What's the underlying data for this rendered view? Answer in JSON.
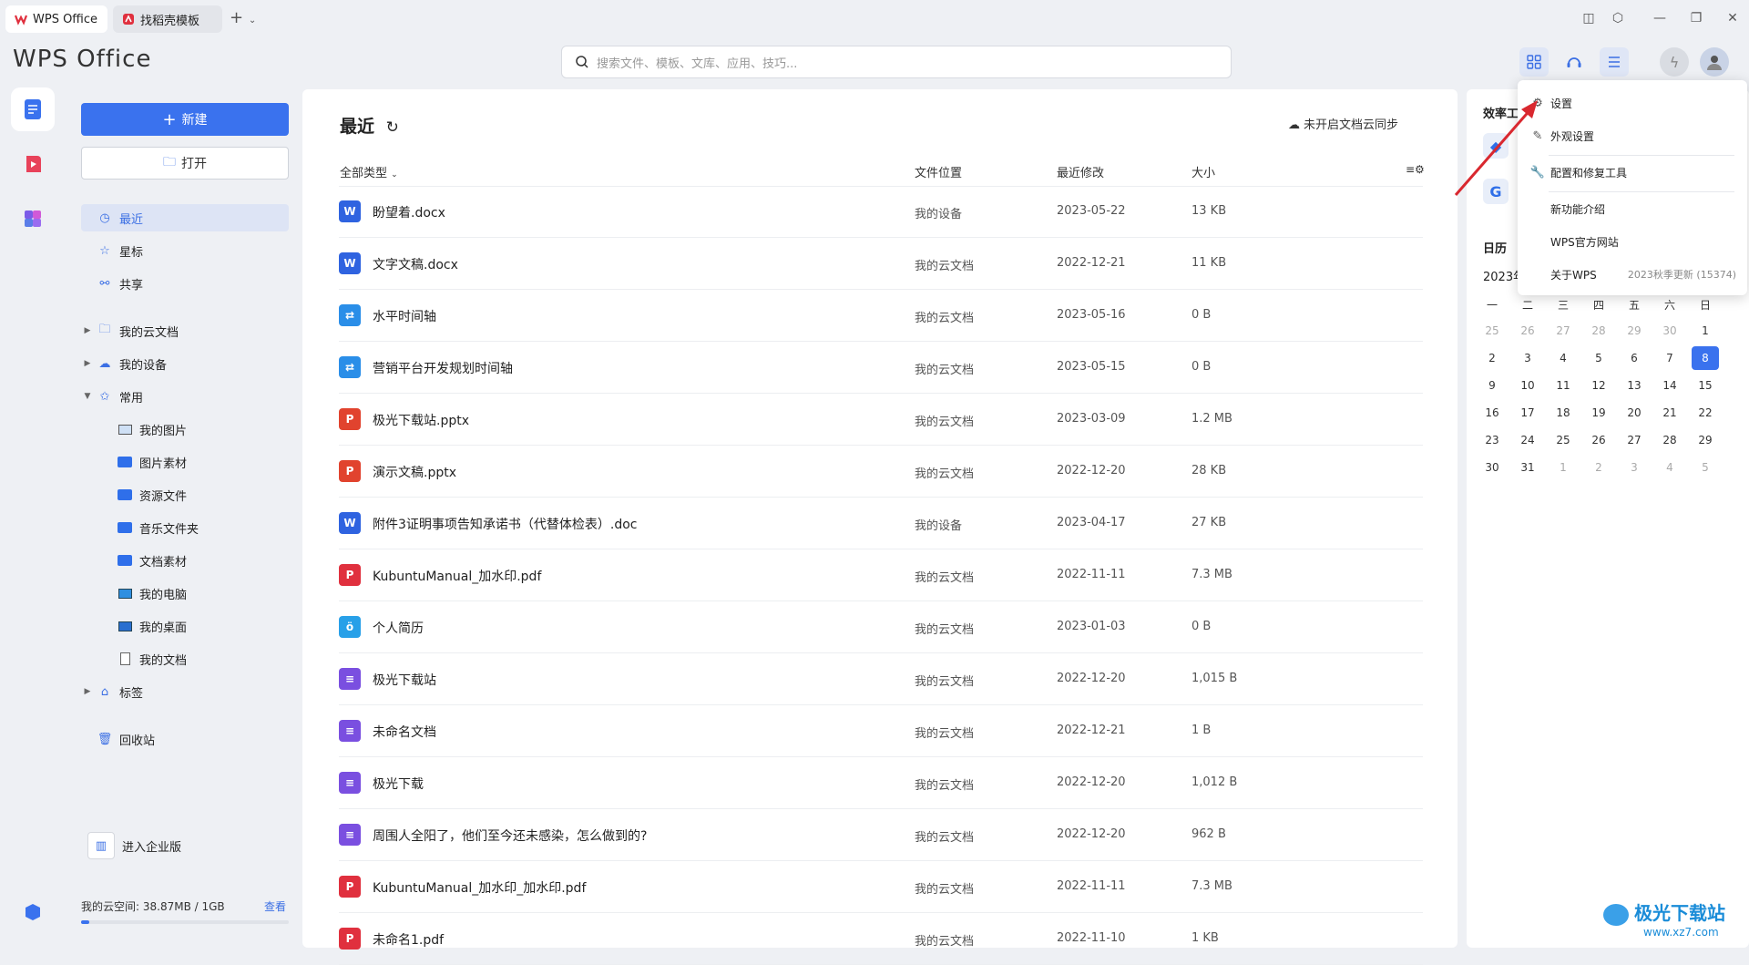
{
  "tabs": [
    {
      "label": "WPS Office"
    },
    {
      "label": "找稻壳模板"
    }
  ],
  "brand": "WPS Office",
  "search": {
    "placeholder": "搜索文件、模板、文库、应用、技巧..."
  },
  "sidebar": {
    "new_label": "新建",
    "open_label": "打开",
    "items": [
      {
        "label": "最近"
      },
      {
        "label": "星标"
      },
      {
        "label": "共享"
      },
      {
        "label": "我的云文档"
      },
      {
        "label": "我的设备"
      },
      {
        "label": "常用"
      },
      {
        "label": "我的图片"
      },
      {
        "label": "图片素材"
      },
      {
        "label": "资源文件"
      },
      {
        "label": "音乐文件夹"
      },
      {
        "label": "文档素材"
      },
      {
        "label": "我的电脑"
      },
      {
        "label": "我的桌面"
      },
      {
        "label": "我的文档"
      },
      {
        "label": "标签"
      },
      {
        "label": "回收站"
      }
    ],
    "enterprise_label": "进入企业版",
    "cloud_space": "我的云空间: 38.87MB / 1GB",
    "cloud_view": "查看",
    "cloud_usage_fraction": 0.038
  },
  "main": {
    "title": "最近",
    "sync_status": "未开启文档云同步",
    "columns": {
      "type": "全部类型",
      "location": "文件位置",
      "modified": "最近修改",
      "size": "大小"
    },
    "files": [
      {
        "name": "盼望着.docx",
        "location": "我的设备",
        "date": "2023-05-22",
        "size": "13 KB",
        "icon": "W",
        "color": "#2f63e0"
      },
      {
        "name": "文字文稿.docx",
        "location": "我的云文档",
        "date": "2022-12-21",
        "size": "11 KB",
        "icon": "W",
        "color": "#2f63e0"
      },
      {
        "name": "水平时间轴",
        "location": "我的云文档",
        "date": "2023-05-16",
        "size": "0 B",
        "icon": "⇄",
        "color": "#2a8ee8"
      },
      {
        "name": "营销平台开发规划时间轴",
        "location": "我的云文档",
        "date": "2023-05-15",
        "size": "0 B",
        "icon": "⇄",
        "color": "#2a8ee8"
      },
      {
        "name": "极光下载站.pptx",
        "location": "我的云文档",
        "date": "2023-03-09",
        "size": "1.2 MB",
        "icon": "P",
        "color": "#e1432e"
      },
      {
        "name": "演示文稿.pptx",
        "location": "我的云文档",
        "date": "2022-12-20",
        "size": "28 KB",
        "icon": "P",
        "color": "#e1432e"
      },
      {
        "name": "附件3证明事项告知承诺书（代替体检表）.doc",
        "location": "我的设备",
        "date": "2023-04-17",
        "size": "27 KB",
        "icon": "W",
        "color": "#2f63e0"
      },
      {
        "name": "KubuntuManual_加水印.pdf",
        "location": "我的云文档",
        "date": "2022-11-11",
        "size": "7.3 MB",
        "icon": "P",
        "color": "#e0303e"
      },
      {
        "name": "个人简历",
        "location": "我的云文档",
        "date": "2023-01-03",
        "size": "0 B",
        "icon": "ö",
        "color": "#28a0e8"
      },
      {
        "name": "极光下载站",
        "location": "我的云文档",
        "date": "2022-12-20",
        "size": "1,015 B",
        "icon": "≡",
        "color": "#7a4fe0"
      },
      {
        "name": "未命名文档",
        "location": "我的云文档",
        "date": "2022-12-21",
        "size": "1 B",
        "icon": "≡",
        "color": "#7a4fe0"
      },
      {
        "name": "极光下载",
        "location": "我的云文档",
        "date": "2022-12-20",
        "size": "1,012 B",
        "icon": "≡",
        "color": "#7a4fe0"
      },
      {
        "name": "周围人全阳了，他们至今还未感染，怎么做到的?",
        "location": "我的云文档",
        "date": "2022-12-20",
        "size": "962 B",
        "icon": "≡",
        "color": "#7a4fe0"
      },
      {
        "name": "KubuntuManual_加水印_加水印.pdf",
        "location": "我的云文档",
        "date": "2022-11-11",
        "size": "7.3 MB",
        "icon": "P",
        "color": "#e0303e"
      },
      {
        "name": "未命名1.pdf",
        "location": "我的云文档",
        "date": "2022-11-10",
        "size": "1 KB",
        "icon": "P",
        "color": "#e0303e"
      }
    ]
  },
  "right_panel": {
    "tools_title": "效率工",
    "calendar_title": "日历",
    "calendar_month": "2023年",
    "weekdays": [
      "一",
      "二",
      "三",
      "四",
      "五",
      "六",
      "日"
    ],
    "weeks": [
      [
        "25",
        "26",
        "27",
        "28",
        "29",
        "30",
        "1"
      ],
      [
        "2",
        "3",
        "4",
        "5",
        "6",
        "7",
        "8"
      ],
      [
        "9",
        "10",
        "11",
        "12",
        "13",
        "14",
        "15"
      ],
      [
        "16",
        "17",
        "18",
        "19",
        "20",
        "21",
        "22"
      ],
      [
        "23",
        "24",
        "25",
        "26",
        "27",
        "28",
        "29"
      ],
      [
        "30",
        "31",
        "1",
        "2",
        "3",
        "4",
        "5"
      ]
    ],
    "today": "8"
  },
  "menu": {
    "items": [
      {
        "label": "设置",
        "icon": "gear-icon"
      },
      {
        "label": "外观设置",
        "icon": "brush-icon"
      },
      {
        "label": "配置和修复工具",
        "icon": "wrench-icon"
      },
      {
        "label": "新功能介绍",
        "icon": ""
      },
      {
        "label": "WPS官方网站",
        "icon": ""
      },
      {
        "label": "关于WPS",
        "icon": ""
      }
    ],
    "version": "2023秋季更新 (15374)"
  },
  "watermark": {
    "name": "极光下载站",
    "url": "www.xz7.com"
  },
  "colors": {
    "accent": "#3a72ee",
    "annotation_arrow": "#d9282f"
  }
}
